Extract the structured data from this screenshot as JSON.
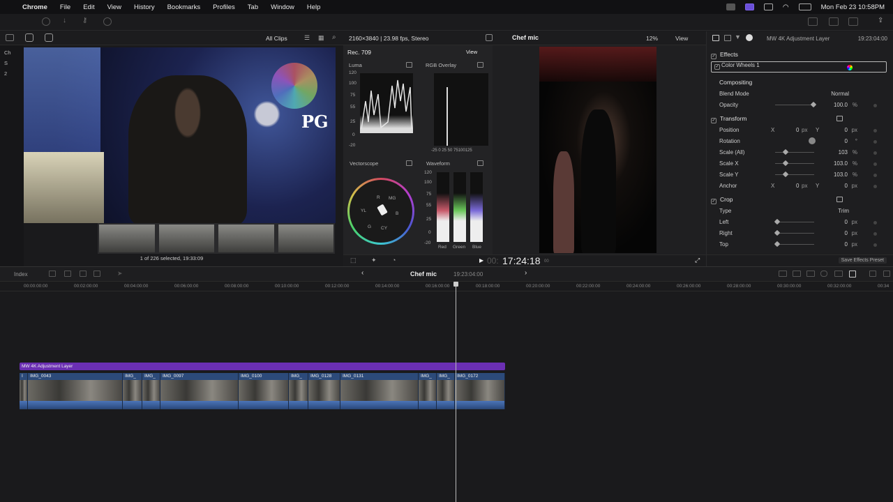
{
  "menubar": {
    "app": "Chrome",
    "items": [
      "File",
      "Edit",
      "View",
      "History",
      "Bookmarks",
      "Profiles",
      "Tab",
      "Window",
      "Help"
    ],
    "datetime": "Mon Feb 23  10:58PM"
  },
  "browser": {
    "filter": "All Clips",
    "sidebar_items": [
      "Ch",
      "S",
      "2"
    ],
    "selection_status": "1 of 226 selected, 19:33:09"
  },
  "scopes": {
    "format": "2160×3840 | 23.98 fps, Stereo",
    "color_space": "Rec. 709",
    "view_menu": "View",
    "luma_label": "Luma",
    "luma_scale": [
      "120",
      "100",
      "75",
      "55",
      "25",
      "0",
      "-20"
    ],
    "rgb_overlay_label": "RGB Overlay",
    "rgb_overlay_scale": "-25  0   25  50  75100125",
    "vectorscope_label": "Vectorscope",
    "vectorscope_targets": [
      "R",
      "MG",
      "B",
      "CY",
      "G",
      "YL"
    ],
    "waveform_label": "Waveform",
    "waveform_scale": [
      "120",
      "100",
      "75",
      "55",
      "25",
      "0",
      "-20"
    ],
    "waveform_channels": [
      "Red",
      "Green",
      "Blue"
    ]
  },
  "viewer": {
    "clip_name": "Chef mic",
    "zoom": "12%",
    "view_menu": "View",
    "timecode": "17:24:18",
    "timecode_prefix": "00:",
    "timecode_frames": "00"
  },
  "inspector": {
    "title": "MW 4K Adjustment Layer",
    "duration": "19:23:04:00",
    "effects_label": "Effects",
    "effect_name": "Color Wheels 1",
    "compositing_label": "Compositing",
    "blend_mode_label": "Blend Mode",
    "blend_mode_value": "Normal",
    "opacity_label": "Opacity",
    "opacity_value": "100.0",
    "transform_label": "Transform",
    "position_label": "Position",
    "position_x": "0",
    "position_y": "0",
    "rotation_label": "Rotation",
    "rotation_value": "0",
    "scale_all_label": "Scale (All)",
    "scale_all_value": "103",
    "scale_x_label": "Scale X",
    "scale_x_value": "103.0",
    "scale_y_label": "Scale Y",
    "scale_y_value": "103.0",
    "anchor_label": "Anchor",
    "anchor_x": "0",
    "anchor_y": "0",
    "crop_label": "Crop",
    "type_label": "Type",
    "type_value": "Trim",
    "left_label": "Left",
    "left_value": "0",
    "right_label": "Right",
    "right_value": "0",
    "top_label": "Top",
    "top_value": "0",
    "save_preset": "Save Effects Preset",
    "px": "px",
    "pct": "%",
    "deg": "°",
    "x": "X",
    "y": "Y"
  },
  "timeline": {
    "index_label": "Index",
    "project": "Chef mic",
    "project_duration": "19:23:04:00",
    "ruler": [
      "00:00:00:00",
      "00:02:00:00",
      "00:04:00:00",
      "00:06:00:00",
      "00:08:00:00",
      "00:10:00:00",
      "00:12:00:00",
      "00:14:00:00",
      "00:16:00:00",
      "00:18:00:00",
      "00:20:00:00",
      "00:22:00:00",
      "00:24:00:00",
      "00:26:00:00",
      "00:28:00:00",
      "00:30:00:00",
      "00:32:00:00",
      "00:34"
    ],
    "adjustment_layer": "MW 4K Adjustment Layer",
    "clips": [
      "I",
      "IMG_0043",
      "IMG_",
      "IMG_",
      "IMG_0097",
      "IMG_0100",
      "IMG_",
      "IMG_0128",
      "IMG_0131",
      "IMG_",
      "IMG_",
      "IMG_0172"
    ]
  }
}
